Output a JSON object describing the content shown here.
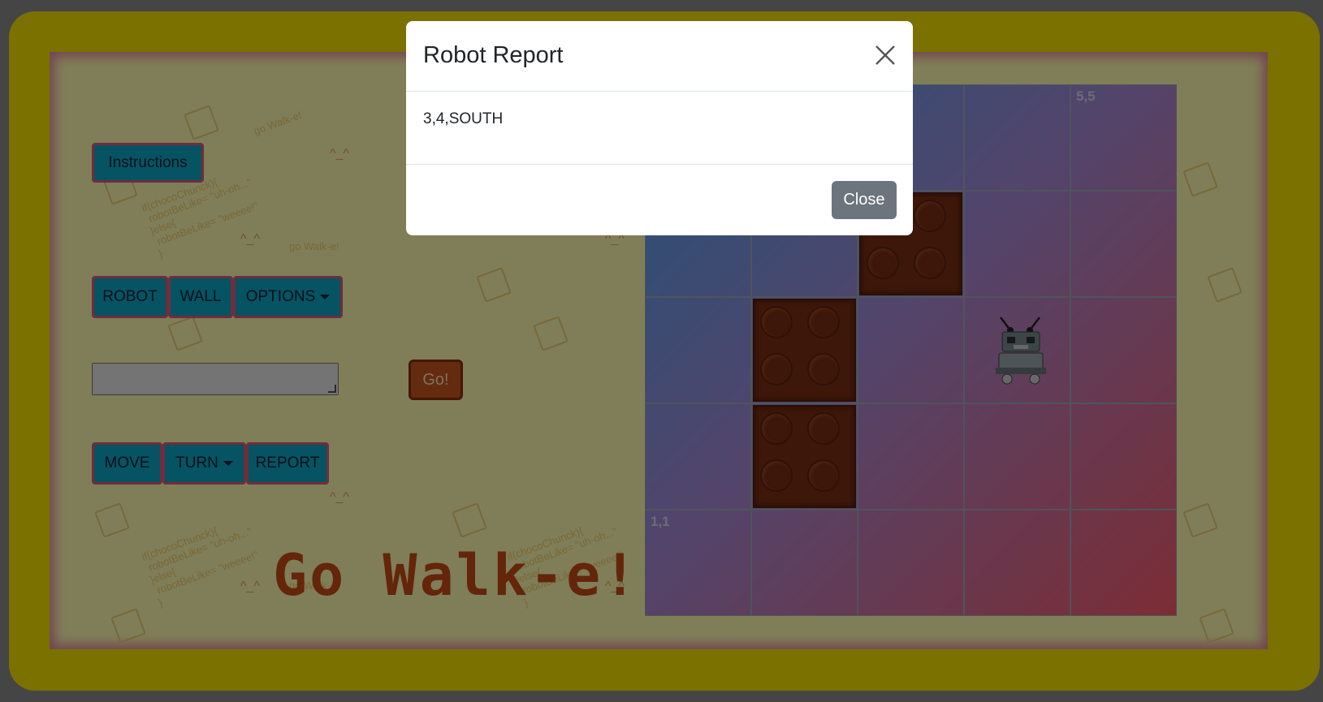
{
  "sidebar": {
    "instructions_label": "Instructions",
    "place_buttons": [
      {
        "label": "ROBOT"
      },
      {
        "label": "WALL"
      },
      {
        "label": "OPTIONS"
      }
    ],
    "go_label": "Go!",
    "action_buttons": [
      {
        "label": "MOVE"
      },
      {
        "label": "TURN"
      },
      {
        "label": "REPORT"
      }
    ]
  },
  "decoration": {
    "code_snippet": "if(chocoChunck){\n robotBeLike= \"uh-oh...\"\n}else{\n robotBeLike= \"weeee!\"\n}",
    "face": "^_^",
    "tagline": "go Walk-e!"
  },
  "title": "Go Walk-e!",
  "grid": {
    "size": 5,
    "top_right_label": "5,5",
    "bottom_left_label": "1,1",
    "walls": [
      [
        3,
        4
      ],
      [
        2,
        3
      ],
      [
        2,
        2
      ]
    ],
    "robot": {
      "x": 4,
      "y": 3
    }
  },
  "modal": {
    "title": "Robot Report",
    "body": "3,4,SOUTH",
    "close_label": "Close"
  },
  "colors": {
    "frame": "#f7e300",
    "button": "#0aa7c7",
    "button_border": "#e05a7a",
    "go_button": "#c8561c",
    "wall": "#7b2e12"
  }
}
